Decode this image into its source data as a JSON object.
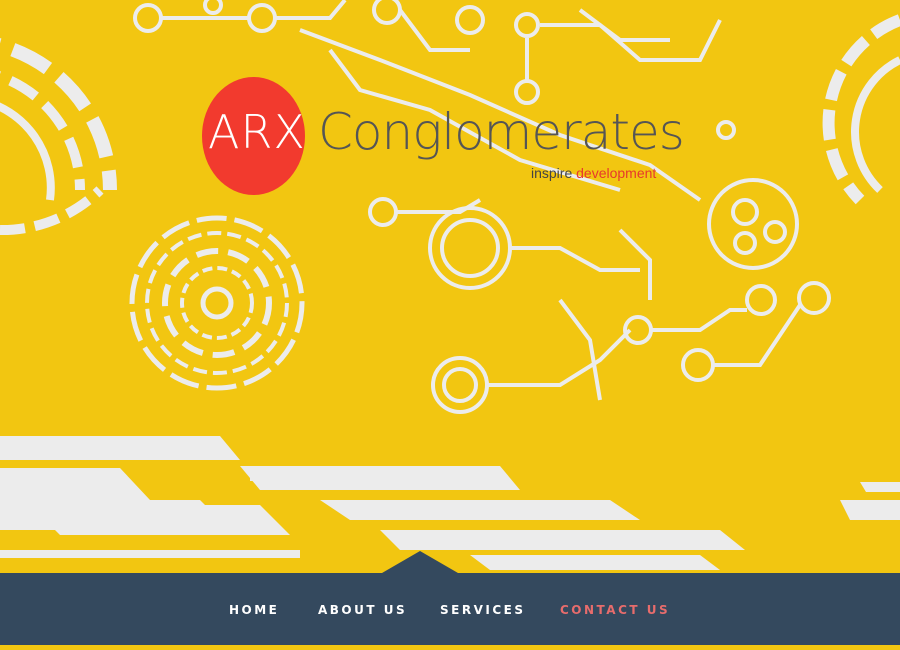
{
  "brand": {
    "mark": "ARX",
    "name": "Conglomerates",
    "tagline_prefix": "inspire",
    "tagline_accent": "development",
    "colors": {
      "mark_bg": "#f23a2e",
      "accent": "#e7392b",
      "background": "#f2c611"
    }
  },
  "nav": {
    "items": [
      {
        "label": "HOME"
      },
      {
        "label": "ABOUT US"
      },
      {
        "label": "SERVICES"
      },
      {
        "label": "CONTACT US"
      }
    ],
    "active_index": 3,
    "colors": {
      "bar": "#34495e",
      "active": "#e76c6c",
      "text": "#ffffff"
    }
  }
}
